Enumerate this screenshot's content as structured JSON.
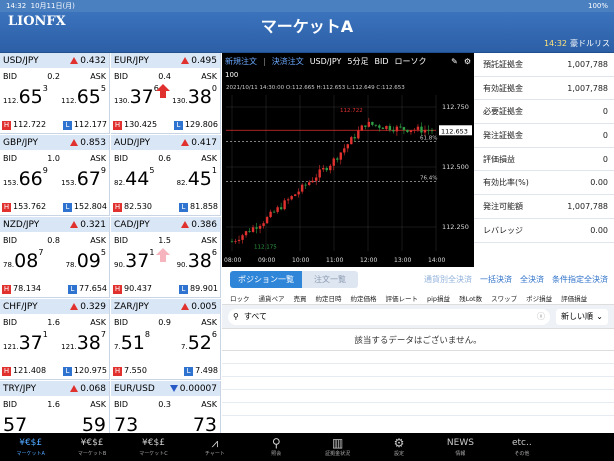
{
  "status": {
    "time": "14:32",
    "date": "10月11日(月)",
    "battery": "100%"
  },
  "header": {
    "logo": "LIONFX",
    "title": "マーケットA",
    "time": "14:32",
    "news": "豪ドルリス"
  },
  "rates": [
    {
      "pair": "USD/JPY",
      "dir": "up",
      "chg": "0.432",
      "bid_label": "BID",
      "spread": "0.2",
      "ask_label": "ASK",
      "bid_pre": "112.",
      "bid_main": "65",
      "bid_sup": "3",
      "ask_pre": "112.",
      "ask_main": "65",
      "ask_sup": "5",
      "high": "112.722",
      "low": "112.177",
      "arrow": ""
    },
    {
      "pair": "EUR/JPY",
      "dir": "up",
      "chg": "0.495",
      "bid_label": "BID",
      "spread": "0.4",
      "ask_label": "ASK",
      "bid_pre": "130.",
      "bid_main": "37",
      "bid_sup": "6",
      "ask_pre": "130.",
      "ask_main": "38",
      "ask_sup": "0",
      "high": "130.425",
      "low": "129.806",
      "arrow": "red"
    },
    {
      "pair": "GBP/JPY",
      "dir": "up",
      "chg": "0.853",
      "bid_label": "BID",
      "spread": "1.0",
      "ask_label": "ASK",
      "bid_pre": "153.",
      "bid_main": "66",
      "bid_sup": "9",
      "ask_pre": "153.",
      "ask_main": "67",
      "ask_sup": "9",
      "high": "153.762",
      "low": "152.804",
      "arrow": ""
    },
    {
      "pair": "AUD/JPY",
      "dir": "up",
      "chg": "0.417",
      "bid_label": "BID",
      "spread": "0.6",
      "ask_label": "ASK",
      "bid_pre": "82.",
      "bid_main": "44",
      "bid_sup": "5",
      "ask_pre": "82.",
      "ask_main": "45",
      "ask_sup": "1",
      "high": "82.530",
      "low": "81.858",
      "arrow": ""
    },
    {
      "pair": "NZD/JPY",
      "dir": "up",
      "chg": "0.321",
      "bid_label": "BID",
      "spread": "0.8",
      "ask_label": "ASK",
      "bid_pre": "78.",
      "bid_main": "08",
      "bid_sup": "7",
      "ask_pre": "78.",
      "ask_main": "09",
      "ask_sup": "5",
      "high": "78.134",
      "low": "77.654",
      "arrow": ""
    },
    {
      "pair": "CAD/JPY",
      "dir": "up",
      "chg": "0.386",
      "bid_label": "BID",
      "spread": "1.5",
      "ask_label": "ASK",
      "bid_pre": "90.",
      "bid_main": "37",
      "bid_sup": "1",
      "ask_pre": "90.",
      "ask_main": "38",
      "ask_sup": "6",
      "high": "90.437",
      "low": "89.901",
      "arrow": "pink"
    },
    {
      "pair": "CHF/JPY",
      "dir": "up",
      "chg": "0.329",
      "bid_label": "BID",
      "spread": "1.6",
      "ask_label": "ASK",
      "bid_pre": "121.",
      "bid_main": "37",
      "bid_sup": "1",
      "ask_pre": "121.",
      "ask_main": "38",
      "ask_sup": "7",
      "high": "121.408",
      "low": "120.975",
      "arrow": ""
    },
    {
      "pair": "ZAR/JPY",
      "dir": "up",
      "chg": "0.005",
      "bid_label": "BID",
      "spread": "0.9",
      "ask_label": "ASK",
      "bid_pre": "7.",
      "bid_main": "51",
      "bid_sup": "8",
      "ask_pre": "7.",
      "ask_main": "52",
      "ask_sup": "6",
      "high": "7.550",
      "low": "7.498",
      "arrow": ""
    },
    {
      "pair": "TRY/JPY",
      "dir": "up",
      "chg": "0.068",
      "bid_label": "BID",
      "spread": "1.6",
      "ask_label": "ASK",
      "bid_pre": "",
      "bid_main": "57",
      "bid_sup": "",
      "ask_pre": "",
      "ask_main": "59",
      "ask_sup": "",
      "high": "",
      "low": "",
      "arrow": ""
    },
    {
      "pair": "EUR/USD",
      "dir": "down",
      "chg": "0.00007",
      "bid_label": "BID",
      "spread": "0.3",
      "ask_label": "ASK",
      "bid_pre": "",
      "bid_main": "73",
      "bid_sup": "",
      "ask_pre": "",
      "ask_main": "73",
      "ask_sup": "",
      "high": "",
      "low": "",
      "arrow": ""
    }
  ],
  "chart": {
    "toolbar": {
      "new_order": "新規注文",
      "settle": "決済注文",
      "pair": "USD/JPY",
      "interval": "5分足",
      "side": "BID",
      "type": "ローソク"
    },
    "hundred": "100",
    "ohlc": "2021/10/11 14:30:00   O:112.665  H:112.653  L:112.649  C:112.653",
    "y_ticks": [
      "112.750",
      "112.653",
      "112.500",
      "112.250"
    ],
    "x_ticks": [
      "08:00",
      "09:00",
      "10:00",
      "11:00",
      "12:00",
      "13:00",
      "14:00"
    ],
    "hi_label": "112.722",
    "lo_label": "112.175",
    "fib1": "61.8%",
    "fib2": "76.4%"
  },
  "chart_data": {
    "type": "candlestick",
    "title": "USD/JPY 5分足 BID",
    "xlabel": "",
    "ylabel": "",
    "x": [
      "08:00",
      "09:00",
      "10:00",
      "11:00",
      "12:00",
      "13:00",
      "14:00"
    ],
    "ylim": [
      112.15,
      112.8
    ],
    "series": [
      {
        "name": "USD/JPY",
        "values": [
          112.19,
          112.28,
          112.4,
          112.52,
          112.68,
          112.66,
          112.653
        ]
      }
    ],
    "current": 112.653
  },
  "account": [
    {
      "label": "預託証拠金",
      "value": "1,007,788"
    },
    {
      "label": "有効証拠金",
      "value": "1,007,788"
    },
    {
      "label": "必要証拠金",
      "value": "0"
    },
    {
      "label": "発注証拠金",
      "value": "0"
    },
    {
      "label": "評価損益",
      "value": "0"
    },
    {
      "label": "有効比率(%)",
      "value": "0.00"
    },
    {
      "label": "発注可能額",
      "value": "1,007,788"
    },
    {
      "label": "レバレッジ",
      "value": "0.00"
    }
  ],
  "positions": {
    "tab_on": "ポジション一覧",
    "tab_off": "注文一覧",
    "links": [
      "通貨別全決済",
      "一括決済",
      "全決済",
      "条件指定全決済"
    ],
    "columns": [
      "ロック",
      "通貨ペア",
      "売買",
      "約定日時",
      "約定価格",
      "評価レート",
      "pip損益",
      "残Lot数",
      "スワップ",
      "ポジ損益",
      "評価損益"
    ],
    "search_value": "すべて",
    "sort": "新しい順",
    "empty": "該当するデータはございません。"
  },
  "tabbar": [
    {
      "label": "マーケットA",
      "icon": "¥€$£",
      "active": true
    },
    {
      "label": "マーケットB",
      "icon": "¥€$£",
      "active": false
    },
    {
      "label": "マーケットC",
      "icon": "¥€$£",
      "active": false
    },
    {
      "label": "チャート",
      "icon": "⩘",
      "active": false
    },
    {
      "label": "照会",
      "icon": "⚲",
      "active": false
    },
    {
      "label": "証拠金状況",
      "icon": "▥",
      "active": false
    },
    {
      "label": "設定",
      "icon": "⚙",
      "active": false
    },
    {
      "label": "情報",
      "icon": "NEWS",
      "active": false
    },
    {
      "label": "その他",
      "icon": "etc..",
      "active": false
    }
  ]
}
